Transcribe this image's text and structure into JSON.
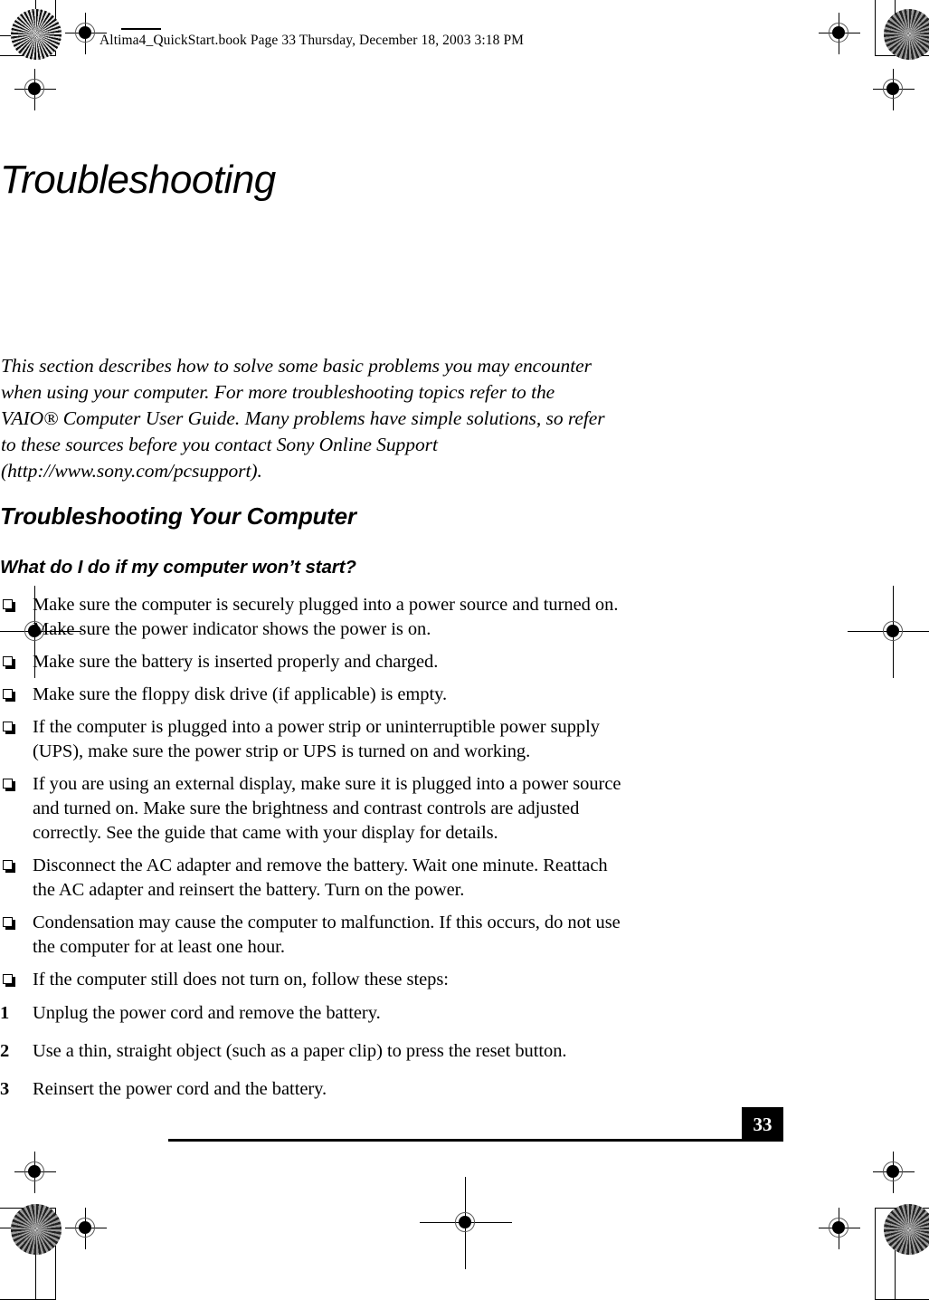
{
  "print_marks": {
    "header_note": "Altima4_QuickStart.book  Page 33  Thursday, December 18, 2003  3:18 PM",
    "rosette_label": "halftone-registration-rosette",
    "registration_label": "registration-target"
  },
  "document": {
    "chapter_title": "Troubleshooting",
    "intro": "This section describes how to solve some basic problems you may encounter when using your computer. For more troubleshooting topics refer to the VAIO® Computer User Guide. Many problems have simple solutions, so refer to these sources before you contact Sony Online Support (http://www.sony.com/pcsupport).",
    "section_heading": "Troubleshooting Your Computer",
    "question_heading": "What do I do if my computer won’t start?",
    "bullets": [
      "Make sure the computer is securely plugged into a power source and turned on. Make sure the power indicator shows the power is on.",
      "Make sure the battery is inserted properly and charged.",
      "Make sure the floppy disk drive (if applicable) is empty.",
      "If the computer is plugged into a power strip or uninterruptible power supply (UPS), make sure the power strip or UPS is turned on and working.",
      "If you are using an external display, make sure it is plugged into a power source and turned on. Make sure the brightness and contrast controls are adjusted correctly. See the guide that came with your display for details.",
      "Disconnect the AC adapter and remove the battery. Wait one minute. Reattach the AC adapter and reinsert the battery. Turn on the power.",
      "Condensation may cause the computer to malfunction. If this occurs, do not use the computer for at least one hour.",
      "If the computer still does not turn on, follow these steps:"
    ],
    "steps": [
      {
        "number": "1",
        "text": "Unplug the power cord and remove the battery."
      },
      {
        "number": "2",
        "text": "Use a thin, straight object (such as a paper clip) to press the reset button."
      },
      {
        "number": "3",
        "text": "Reinsert the power cord and the battery."
      }
    ],
    "page_number": "33"
  }
}
